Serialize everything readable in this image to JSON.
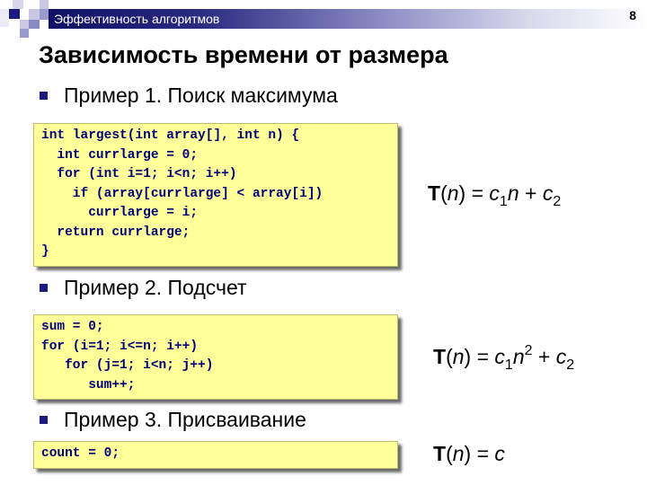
{
  "header": {
    "title": "Эффективность алгоритмов",
    "slide_number": "8",
    "bar_color": "#101066"
  },
  "slide": {
    "title": "Зависимость времени от размера",
    "examples": [
      {
        "label": "Пример 1. Поиск максимума",
        "code": [
          "int largest(int array[], int n) {",
          "  int currlarge = 0;",
          "  for (int i=1; i<n; i++)",
          "    if (array[currlarge] < array[i])",
          "      currlarge = i;",
          "  return currlarge;",
          "}"
        ],
        "formula": {
          "T": "T",
          "lp": "(",
          "n": "n",
          "rp_eq": ") = ",
          "c1": "c",
          "s1": "1",
          "rest1": "n",
          "sup": "",
          "plus": " + ",
          "c2": "c",
          "s2": "2"
        }
      },
      {
        "label": "Пример 2. Подсчет",
        "code": [
          "sum = 0;",
          "for (i=1; i<=n; i++)",
          "   for (j=1; i<n; j++)",
          "      sum++;"
        ],
        "formula": {
          "T": "T",
          "lp": "(",
          "n": "n",
          "rp_eq": ") = ",
          "c1": "c",
          "s1": "1",
          "rest1": "n",
          "sup": "2",
          "plus": " + ",
          "c2": "c",
          "s2": "2"
        }
      },
      {
        "label": "Пример 3. Присваивание",
        "code": [
          "count = 0;"
        ],
        "formula": {
          "T": "T",
          "lp": "(",
          "n": "n",
          "rp_eq": ") = ",
          "c": "c"
        }
      }
    ]
  },
  "colors": {
    "code_background": "#ffff99",
    "code_text": "#00007a",
    "bullet": "#1a1a80"
  }
}
